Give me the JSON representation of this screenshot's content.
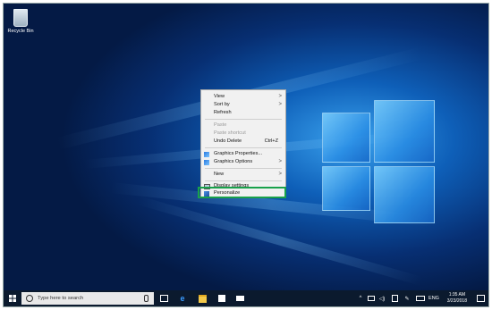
{
  "desktop": {
    "recycle_bin_label": "Recycle Bin"
  },
  "context_menu": {
    "items": [
      {
        "label": "View",
        "arrow": ">"
      },
      {
        "label": "Sort by",
        "arrow": ">"
      },
      {
        "label": "Refresh"
      },
      {
        "label": "Paste",
        "disabled": true
      },
      {
        "label": "Paste shortcut",
        "disabled": true
      },
      {
        "label": "Undo Delete",
        "shortcut": "Ctrl+Z"
      },
      {
        "label": "Graphics Properties...",
        "icon": "graphics-icon"
      },
      {
        "label": "Graphics Options",
        "icon": "graphics-icon",
        "arrow": ">"
      },
      {
        "label": "New",
        "arrow": ">"
      },
      {
        "label": "Display settings",
        "icon": "display-icon"
      },
      {
        "label": "Personalize",
        "icon": "personalize-icon"
      }
    ],
    "highlight_color": "#19a14a"
  },
  "taskbar": {
    "search_placeholder": "Type here to search",
    "tray_language": "ENG",
    "clock_time": "1:35 AM",
    "clock_date": "3/23/2018"
  }
}
